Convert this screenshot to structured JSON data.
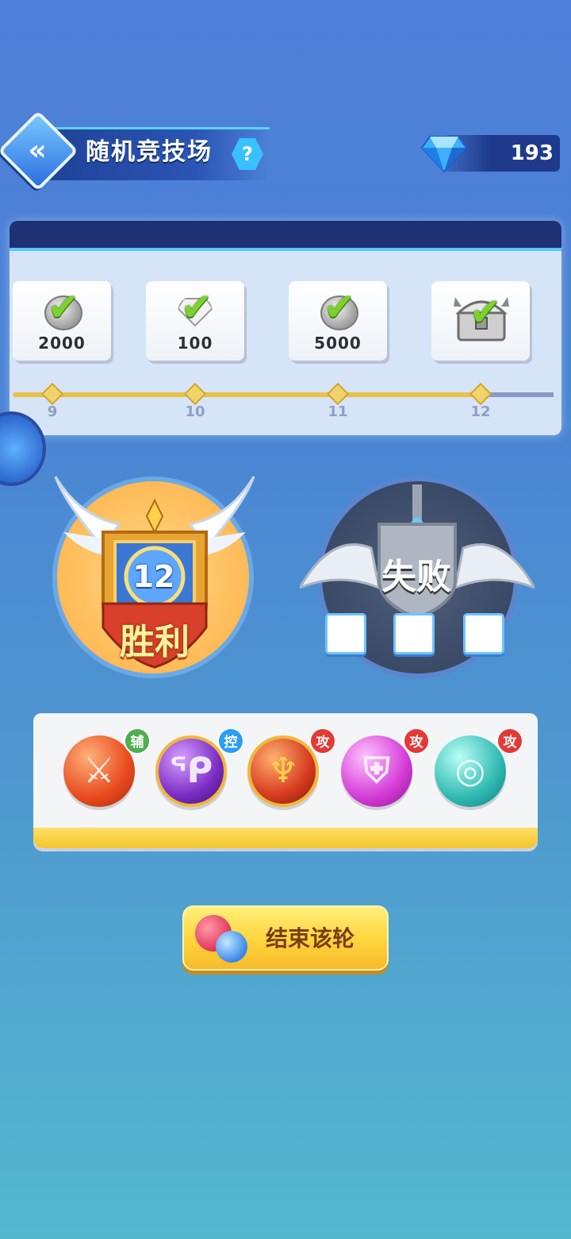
{
  "header": {
    "title": "随机竞技场",
    "help_label": "?",
    "gem_count": "193"
  },
  "progress": {
    "rewards": [
      {
        "amount": "2000",
        "claimed": true,
        "type": "silver-coin"
      },
      {
        "amount": "100",
        "claimed": true,
        "type": "diamond"
      },
      {
        "amount": "5000",
        "claimed": true,
        "type": "silver-coin"
      },
      {
        "amount": "",
        "claimed": true,
        "type": "treasure-chest"
      }
    ],
    "milestones": [
      "9",
      "10",
      "11",
      "12"
    ]
  },
  "record": {
    "wins": "12",
    "win_label": "胜利",
    "loss_label": "失败",
    "losses_used": 0,
    "loss_slots": 3
  },
  "team": {
    "heroes": [
      {
        "role": "辅",
        "icon": "crossed-swords-icon",
        "glyph": "⚔",
        "color": "#e84a1e",
        "badge_color": "#4caf50"
      },
      {
        "role": "控",
        "icon": "hook-icon",
        "glyph": "ᕿ",
        "color": "#7b2cc4",
        "badge_color": "#2a9df4"
      },
      {
        "role": "攻",
        "icon": "dragon-icon",
        "glyph": "♆",
        "color": "#d63a1e",
        "badge_color": "#e53935"
      },
      {
        "role": "攻",
        "icon": "shield-icon",
        "glyph": "⛨",
        "color": "#d33bd6",
        "badge_color": "#e53935"
      },
      {
        "role": "攻",
        "icon": "swirl-icon",
        "glyph": "◎",
        "color": "#2fb9b2",
        "badge_color": "#e53935"
      }
    ]
  },
  "actions": {
    "end_button": "结束该轮"
  },
  "colors": {
    "accent": "#53c9ff",
    "track": "#e8c247",
    "button": "#ffd43c"
  }
}
